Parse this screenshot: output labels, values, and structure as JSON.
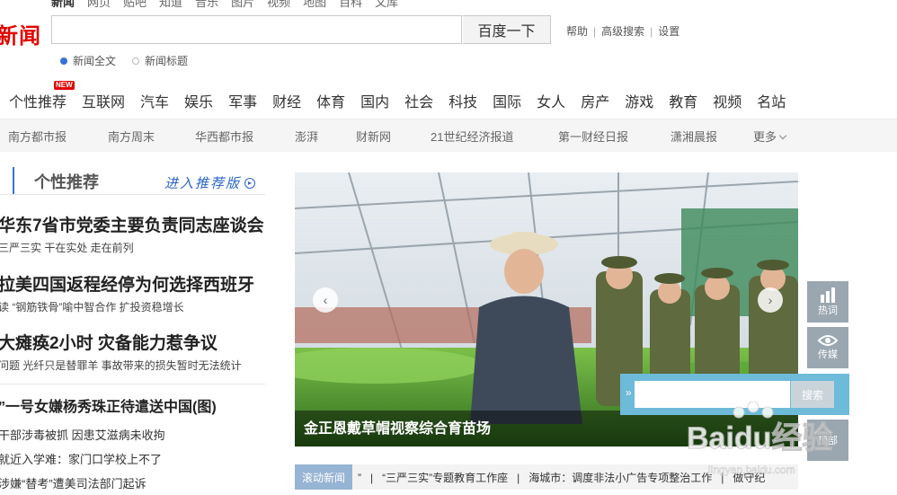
{
  "top_nav": {
    "items": [
      "新闻",
      "网页",
      "贴吧",
      "知道",
      "音乐",
      "图片",
      "视频",
      "地图",
      "百科",
      "文库"
    ]
  },
  "logo": {
    "text": "新闻"
  },
  "search": {
    "value": "",
    "button": "百度一下",
    "links": [
      "帮助",
      "高级搜索",
      "设置"
    ],
    "options": [
      "新闻全文",
      "新闻标题"
    ],
    "selected_option": "新闻全文"
  },
  "categories": {
    "badge": "NEW",
    "items": [
      "个性推荐",
      "互联网",
      "汽车",
      "娱乐",
      "军事",
      "财经",
      "体育",
      "国内",
      "社会",
      "科技",
      "国际",
      "女人",
      "房产",
      "游戏",
      "教育",
      "视频",
      "名站"
    ]
  },
  "media": {
    "items": [
      "南方都市报",
      "南方周末",
      "华西都市报",
      "澎湃",
      "财新网",
      "21世纪经济报道",
      "第一财经日报",
      "潇湘晨报"
    ],
    "more": "更多"
  },
  "recommend": {
    "tab_title": "个性推荐",
    "enter_link": "进入推荐版",
    "headlines": [
      {
        "title": "华东7省市党委主要负责同志座谈会",
        "sub": "三严三实 干在实处 走在前列"
      },
      {
        "title": "拉美四国返程经停为何选择西班牙",
        "sub": "读 “钢筋铁骨”喻中智合作 扩投资稳增长"
      },
      {
        "title": "大瘫痪2小时 灾备能力惹争议",
        "sub": "问题 光纤只是替罪羊 事故带来的损失暂时无法统计"
      }
    ],
    "list": [
      "”一号女嫌杨秀珠正待遣送中国(图)",
      "干部涉毒被抓 因患艾滋病未收拘",
      "就近入学难：家门口学校上不了",
      "涉嫌“替考”遭美司法部门起诉"
    ]
  },
  "carousel": {
    "caption": "金正恩戴草帽视察综合育苗场"
  },
  "tools": {
    "hot_label": "热词",
    "media_label": "传媒",
    "search_button": "搜索",
    "top_label": "顶部"
  },
  "ticker": {
    "label": "滚动新闻",
    "items": [
      "”",
      "“三严三实”专题教育工作座",
      "海城市：调度非法小广告专项整治工作",
      "做守纪"
    ]
  },
  "watermark": {
    "text": "Baidu经验",
    "sub": "jingyan.baidu.com"
  },
  "colors": {
    "brand_red": "#e10601",
    "link_blue": "#2b67c9",
    "float_blue": "#6ebad9",
    "tool_gray": "#9aa7b1"
  }
}
